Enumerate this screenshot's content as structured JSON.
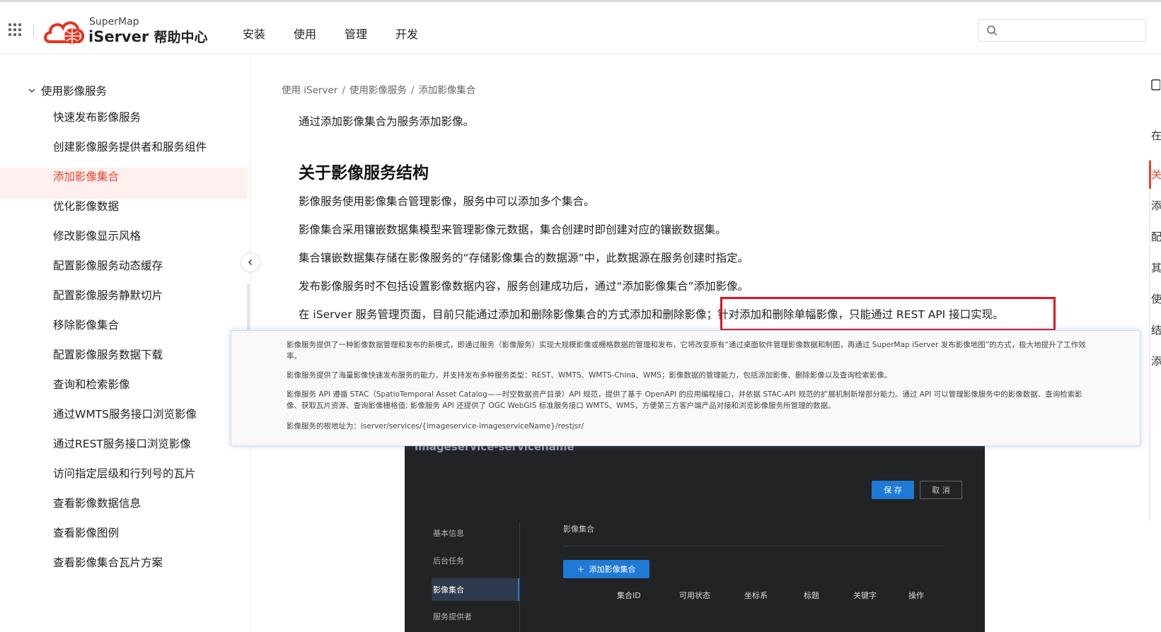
{
  "header": {
    "brand_top": "SuperMap",
    "brand_main": "iServer",
    "brand_cn": "帮助中心",
    "nav": [
      "安装",
      "使用",
      "管理",
      "开发"
    ],
    "search_placeholder": ""
  },
  "sidebar": {
    "section": "使用影像服务",
    "items": [
      "快速发布影像服务",
      "创建影像服务提供者和服务组件",
      "添加影像集合",
      "优化影像数据",
      "修改影像显示风格",
      "配置影像服务动态缓存",
      "配置影像服务静默切片",
      "移除影像集合",
      "配置影像服务数据下载",
      "查询和检索影像",
      "通过WMTS服务接口浏览影像",
      "通过REST服务接口浏览影像",
      "访问指定层级和行列号的瓦片",
      "查看影像数据信息",
      "查看影像图例",
      "查看影像集合瓦片方案"
    ],
    "active_index": 2
  },
  "content": {
    "breadcrumb": [
      "使用 iServer",
      "使用影像服务",
      "添加影像集合"
    ],
    "intro": "通过添加影像集合为服务添加影像。",
    "heading": "关于影像服务结构",
    "paragraphs": [
      "影像服务使用影像集合管理影像，服务中可以添加多个集合。",
      "影像集合采用镶嵌数据集模型来管理影像元数据，集合创建时即创建对应的镶嵌数据集。",
      "集合镶嵌数据集存储在影像服务的“存储影像集合的数据源”中，此数据源在服务创建时指定。",
      "发布影像服务时不包括设置影像数据内容，服务创建成功后，通过“添加影像集合”添加影像。"
    ],
    "last_para_a": "在 iServer 服务管理页面，目前只能通过添加和删除影像集合的方式添加和删除影像；",
    "last_para_b": "针对添加和删除单幅影像，只能通过 REST API 接口实现。"
  },
  "popup": {
    "lines": [
      "影像服务提供了一种影像数据管理和发布的新模式，即通过服务（影像服务）实现大规模影像或栅格数据的管理和发布，它将改变原有“通过桌面软件管理影像数据和制图，再通过 SuperMap iServer 发布影像地图”的方式，极大地提升了工作效率。",
      "影像服务提供了海量影像快速发布服务的能力，并支持发布多种服务类型：REST、WMTS、WMTS-China、WMS；影像数据的管理能力，包括添加影像、删除影像以及查询检索影像。",
      "影像服务 API 遵循 STAC（SpatioTemporal Asset Catalog——时空数据资产目录）API 规范，提供了基于 OpenAPI 的应用编程接口，并依据 STAC-API 规范的扩展机制新增部分能力。通过 API 可以管理影像服务中的影像数据、查询检索影像、获取瓦片资源、查询影像栅格值; 影像服务 API 还提供了 OGC WebGIS 标准服务接口 WMTS、WMS，方便第三方客户端产品对接和浏览影像服务所管理的数据。",
      "影像服务的根地址为：iserver/services/{imageservice-imageserviceName}/restjsr/"
    ]
  },
  "screenshot": {
    "title": "imageservice-servicename",
    "save": "保 存",
    "cancel": "取 消",
    "nav": [
      "基本信息",
      "后台任务",
      "影像集合",
      "服务提供者"
    ],
    "section": "影像集合",
    "add_button": "添加影像集合",
    "columns": [
      "集合ID",
      "可用状态",
      "坐标系",
      "标题",
      "关键字",
      "操作"
    ]
  },
  "right_panel": {
    "label": "在",
    "items": [
      "关",
      "添",
      "配",
      "其",
      "使",
      "结",
      "添"
    ]
  }
}
